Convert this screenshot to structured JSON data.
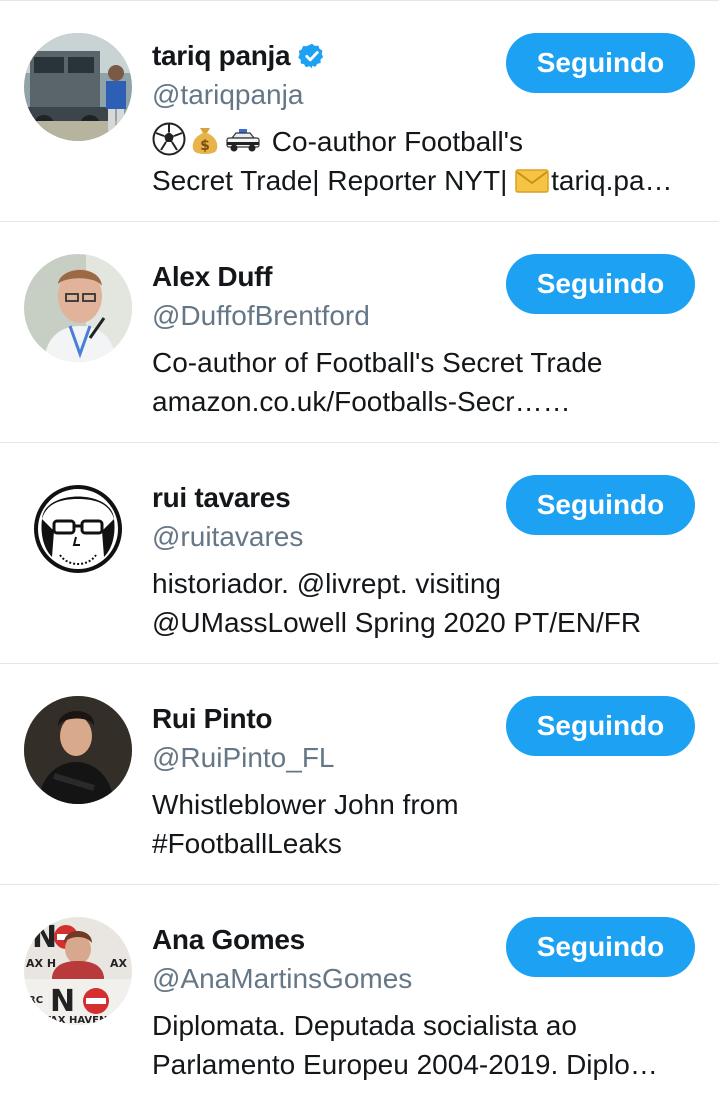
{
  "accent_color": "#1da1f2",
  "users": [
    {
      "name": "tariq panja",
      "handle": "@tariqpanja",
      "verified": true,
      "bio_line1": "Co-author Football's",
      "bio_line1_icons": [
        "soccer-ball-icon",
        "money-bag-icon",
        "police-car-icon"
      ],
      "bio_line2_a": "Secret Trade| Reporter NYT|",
      "bio_line2_icon": "envelope-icon",
      "bio_line2_b": "tariq.pa…",
      "button": "Seguindo"
    },
    {
      "name": "Alex Duff",
      "handle": "@DuffofBrentford",
      "verified": false,
      "bio_line1": "Co-author of Football's Secret Trade",
      "bio_line2": "amazon.co.uk/Footballs-Secr……",
      "button": "Seguindo"
    },
    {
      "name": "rui tavares",
      "handle": "@ruitavares",
      "verified": false,
      "bio_line1": "historiador. @livrept. visiting",
      "bio_line2": "@UMassLowell Spring 2020 PT/EN/FR",
      "button": "Seguindo"
    },
    {
      "name": "Rui Pinto",
      "handle": "@RuiPinto_FL",
      "verified": false,
      "bio_line1": "Whistleblower John from",
      "bio_line2": "#FootballLeaks",
      "button": "Seguindo"
    },
    {
      "name": "Ana Gomes",
      "handle": "@AnaMartinsGomes",
      "verified": false,
      "bio_line1": "Diplomata. Deputada socialista ao",
      "bio_line2": "Parlamento Europeu 2004-2019.  Diplo…",
      "avatar_text": [
        "NO",
        "TAX HAVEN"
      ],
      "button": "Seguindo"
    }
  ]
}
